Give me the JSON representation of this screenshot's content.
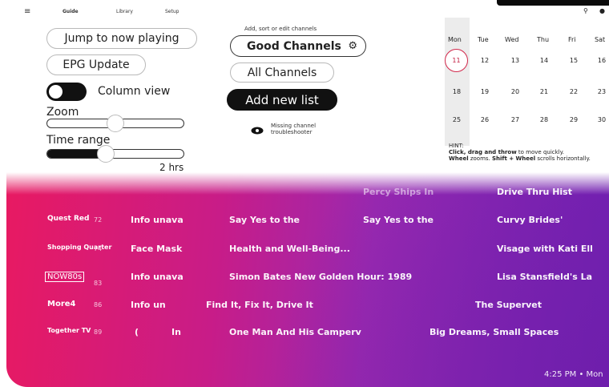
{
  "topbar": {
    "tabs": [
      "Guide",
      "Library",
      "Setup"
    ],
    "menu_icon": "hamburger-menu-icon",
    "right_icons": [
      "location-pin-icon",
      "settings-icon"
    ]
  },
  "left": {
    "jump_label": "Jump to now playing",
    "epg_update_label": "EPG Update",
    "column_view_label": "Column view",
    "column_view_on": true,
    "zoom_label": "Zoom",
    "zoom_level": 0.4,
    "time_range_label": "Time range",
    "time_range_value": "2 hrs",
    "time_range_level": 0.4
  },
  "middle": {
    "hint_label": "Add, sort or edit channels",
    "selected_list": "Good Channels",
    "all_channels_label": "All Channels",
    "add_list_label": "Add new list",
    "missing_line1": "Missing channel",
    "missing_line2": "troubleshooter"
  },
  "calendar": {
    "days": [
      "Mon",
      "Tue",
      "Wed",
      "Thu",
      "Fri",
      "Sat"
    ],
    "weeks": [
      [
        "11",
        "12",
        "13",
        "14",
        "15",
        "16"
      ],
      [
        "18",
        "19",
        "20",
        "21",
        "22",
        "23"
      ],
      [
        "25",
        "26",
        "27",
        "28",
        "29",
        "30"
      ]
    ],
    "today": "11",
    "hint_title": "HINT:",
    "hint_text_1": "Click, drag and throw",
    "hint_text_2": " to move quickly.",
    "hint_text_3": "Wheel",
    "hint_text_4": " zooms. ",
    "hint_text_5": "Shift + Wheel",
    "hint_text_6": " scrolls horizontally."
  },
  "epg": {
    "rows": [
      {
        "logo": "",
        "number": "",
        "programs": [
          "Percy Ships In",
          "Drive Thru Hist"
        ]
      },
      {
        "logo": "Quest Red",
        "number": "72",
        "programs": [
          "Info unava",
          "Say Yes to the",
          "Say Yes to the",
          "Curvy Brides'"
        ]
      },
      {
        "logo": "Shopping Quarter",
        "number": "74",
        "programs": [
          "Face Mask",
          "Health and Well-Being...",
          "Visage with Kati Ell"
        ]
      },
      {
        "logo": "NOW80s",
        "number": "83",
        "programs": [
          "Info unava",
          "Simon Bates New Golden Hour: 1989",
          "Lisa Stansfield's La"
        ]
      },
      {
        "logo": "More4",
        "number": "86",
        "programs": [
          "Info un",
          "Find It, Fix It, Drive It",
          "The Supervet"
        ]
      },
      {
        "logo": "Together TV",
        "number": "89",
        "programs": [
          "(",
          "In",
          "One Man And His Camperv",
          "Big Dreams, Small Spaces"
        ]
      }
    ],
    "status": "4:25 PM • Mon"
  },
  "colors": {
    "accent": "#d2294c",
    "gradient_start": "#e81a62",
    "gradient_end": "#7422b6"
  }
}
